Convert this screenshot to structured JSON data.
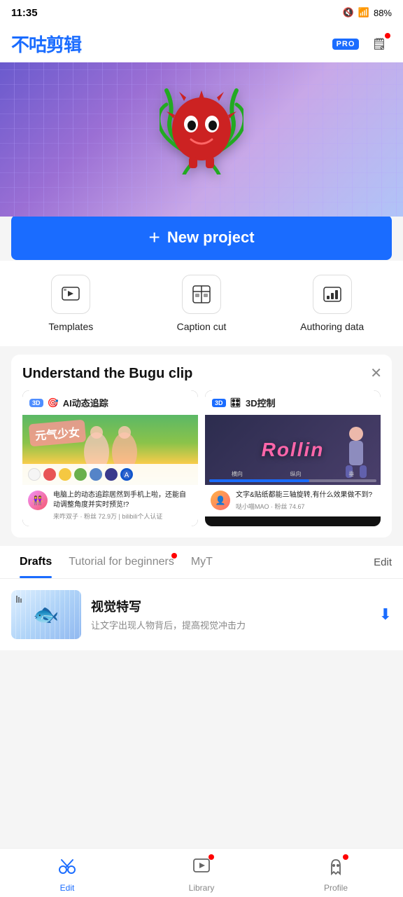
{
  "statusBar": {
    "time": "11:35",
    "battery": "88%"
  },
  "header": {
    "logo": "不咕剪辑",
    "proBadge": "PRO"
  },
  "hero": {
    "monster": "🔴"
  },
  "newProject": {
    "label": "New project",
    "plus": "+"
  },
  "quickActions": [
    {
      "id": "templates",
      "label": "Templates",
      "icon": "▶"
    },
    {
      "id": "caption-cut",
      "label": "Caption cut",
      "icon": "⊞"
    },
    {
      "id": "authoring-data",
      "label": "Authoring data",
      "icon": "📊"
    }
  ],
  "infoBanner": {
    "title": "Understand the Bugu clip",
    "closeIcon": "✕",
    "cards": [
      {
        "headerIcon": "🔴",
        "headerBadge": "3D",
        "headerText": "AI动态追踪",
        "cardOverlay": "元气少女",
        "avatarText": "👭",
        "description": "电脑上的动态追踪居然到手机上啦，还能自动调整角度并实时预览!?",
        "meta": "来咋双子 · 粉丝 72.9万 | bilibili个人认证",
        "palette": [
          "#f5f5f5",
          "#e85555",
          "#f5c842",
          "#6ab04c",
          "#5584c8",
          "#3a3a8c"
        ]
      },
      {
        "headerIcon": "🔵",
        "headerBadge": "3D",
        "headerText": "3D控制",
        "rollinText": "Rollin",
        "avatarText": "👤",
        "description": "文字&贴纸都能三轴旋转,有什么效果做不到?",
        "meta": "哒小喵MAO · 粉丝 74.67",
        "subLabels": [
          "横向",
          "纵向",
          "垂"
        ]
      }
    ]
  },
  "tabs": {
    "items": [
      "Drafts",
      "Tutorial for beginners",
      "MyT"
    ],
    "activeIndex": 0,
    "editLabel": "Edit",
    "notifOnIndex": 1
  },
  "draft": {
    "title": "视觉特写",
    "description": "让文字出现人物背后，提高视觉冲击力",
    "downloadIcon": "⬇"
  },
  "bottomNav": {
    "items": [
      {
        "id": "edit",
        "label": "Edit",
        "icon": "✂",
        "active": true
      },
      {
        "id": "library",
        "label": "Library",
        "icon": "▶",
        "hasNotif": true
      },
      {
        "id": "profile",
        "label": "Profile",
        "icon": "👻",
        "hasNotif": true
      }
    ]
  },
  "sysNav": {
    "back": "❮",
    "home": "◯",
    "recents": "☰"
  }
}
